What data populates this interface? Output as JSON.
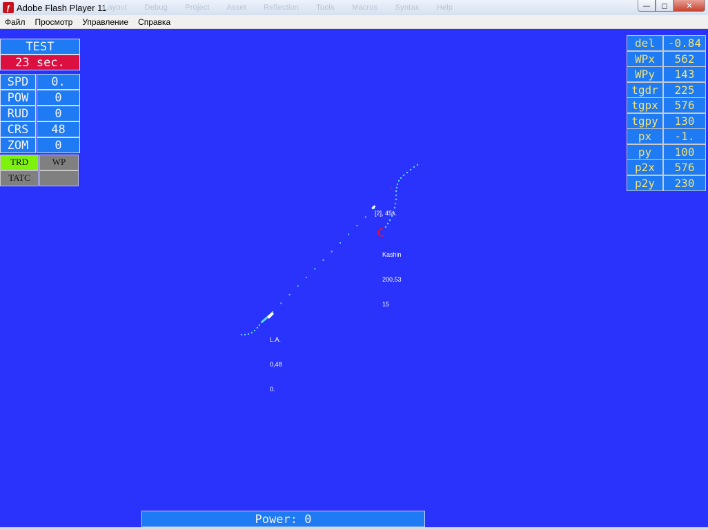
{
  "window": {
    "title": "Adobe Flash Player 11",
    "ghost_menu": "Layout Debug Project Asset Reflection Tools Macros Syntax Help",
    "min_glyph": "—",
    "max_glyph": "◻",
    "close_glyph": "✕",
    "app_icon_glyph": "f"
  },
  "menubar": {
    "items": [
      "Файл",
      "Просмотр",
      "Управление",
      "Справка"
    ]
  },
  "left_panel": {
    "title": "TEST",
    "timer": "23 sec.",
    "rows": [
      {
        "label": "SPD",
        "value": "0."
      },
      {
        "label": "POW",
        "value": "0"
      },
      {
        "label": "RUD",
        "value": "0"
      },
      {
        "label": "CRS",
        "value": "48"
      },
      {
        "label": "ZOM",
        "value": "0"
      }
    ],
    "buttons": {
      "trd": "TRD",
      "wp": "WP",
      "tatc": "TATC"
    },
    "colors": {
      "trd_active": "#7cf20d",
      "inactive": "#808080",
      "timer": "#dc1040"
    }
  },
  "right_panel": {
    "rows": [
      {
        "key": "del",
        "value": "-0.84"
      },
      {
        "key": "WPx",
        "value": "562"
      },
      {
        "key": "WPy",
        "value": "143"
      },
      {
        "key": "tgdr",
        "value": "225"
      },
      {
        "key": "tgpx",
        "value": "576"
      },
      {
        "key": "tgpy",
        "value": "130"
      },
      {
        "key": "px",
        "value": "-1."
      },
      {
        "key": "py",
        "value": "100"
      },
      {
        "key": "p2x",
        "value": "576"
      },
      {
        "key": "p2y",
        "value": "230"
      }
    ]
  },
  "map": {
    "background": "#2a33fb",
    "track_color": "#5fd6ff",
    "target_color": "#e0103a",
    "contacts": {
      "waypoint": {
        "line1": "[2], 45s."
      },
      "kashin": {
        "line1": "Kashin",
        "line2": "200,53",
        "line3": "15"
      },
      "own": {
        "line1": "L.A.",
        "line2": "0,48",
        "line3": "0."
      }
    }
  },
  "power": {
    "label": "Power:",
    "value": "0"
  }
}
